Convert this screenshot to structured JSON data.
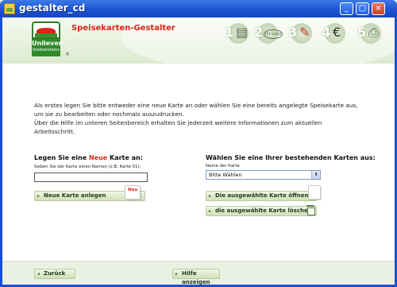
{
  "window": {
    "title": "gestalter_cd",
    "minimize": "_",
    "maximize": "□",
    "close": "×"
  },
  "brand": {
    "logo_name": "Unilever",
    "logo_sub": "foodsolutions",
    "registered": "®"
  },
  "header": {
    "page_title": "Speisekarten-Gestalter",
    "steps": [
      {
        "number": "1",
        "icon": "pages-icon"
      },
      {
        "number": "2",
        "icon": "logo-icon",
        "label": "Ihr Logo"
      },
      {
        "number": "3",
        "icon": "pencil-icon"
      },
      {
        "number": "4",
        "icon": "euro-icon",
        "glyph": "€"
      },
      {
        "number": "5",
        "icon": "printer-icon"
      }
    ]
  },
  "intro": {
    "line1": "Als erstes legen Sie bitte entweder eine neue Karte an oder wählen Sie eine bereits angelegte Speisekarte aus,",
    "line2": "um sie zu bearbeiten oder nochmals auszudrucken.",
    "line3": "Über die Hilfe im unteren Seitenbereich erhalten Sie jederzeit weitere Informationen zum aktuellen",
    "line4": "Arbeitsschritt."
  },
  "new_card": {
    "title_prefix": "Legen Sie eine ",
    "title_highlight": "Neue",
    "title_suffix": " Karte an:",
    "field_label": "Geben Sie der Karte einen Namen (z.B. Karte 01):",
    "input_value": "",
    "button_label": "Neue Karte anlegen",
    "badge": "Neu"
  },
  "existing_card": {
    "title": "Wählen Sie eine Ihrer bestehenden Karten aus:",
    "field_label": "Name der Karte",
    "select_value": "Bitte Wählen",
    "open_button": "Die ausgewählte Karte öffnen",
    "delete_button": "die ausgewählte Karte löschen"
  },
  "footer": {
    "back_button": "Zurück",
    "help_button": "Hilfe anzeigen"
  }
}
